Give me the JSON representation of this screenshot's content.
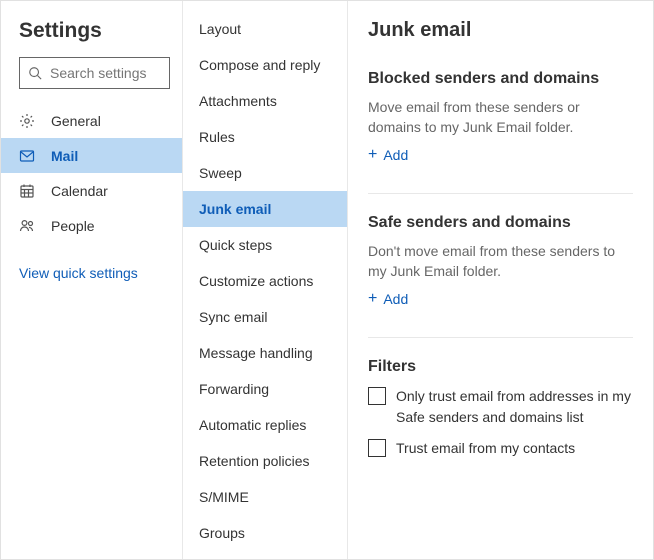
{
  "sidebar": {
    "title": "Settings",
    "search_placeholder": "Search settings",
    "items": [
      {
        "label": "General"
      },
      {
        "label": "Mail"
      },
      {
        "label": "Calendar"
      },
      {
        "label": "People"
      }
    ],
    "quick_link": "View quick settings"
  },
  "midlist": {
    "items": [
      "Layout",
      "Compose and reply",
      "Attachments",
      "Rules",
      "Sweep",
      "Junk email",
      "Quick steps",
      "Customize actions",
      "Sync email",
      "Message handling",
      "Forwarding",
      "Automatic replies",
      "Retention policies",
      "S/MIME",
      "Groups"
    ],
    "active_index": 5
  },
  "content": {
    "title": "Junk email",
    "blocked": {
      "title": "Blocked senders and domains",
      "desc": "Move email from these senders or domains to my Junk Email folder.",
      "add": "Add"
    },
    "safe": {
      "title": "Safe senders and domains",
      "desc": "Don't move email from these senders to my Junk Email folder.",
      "add": "Add"
    },
    "filters": {
      "title": "Filters",
      "opt1": "Only trust email from addresses in my Safe senders and domains list",
      "opt2": "Trust email from my contacts"
    }
  }
}
